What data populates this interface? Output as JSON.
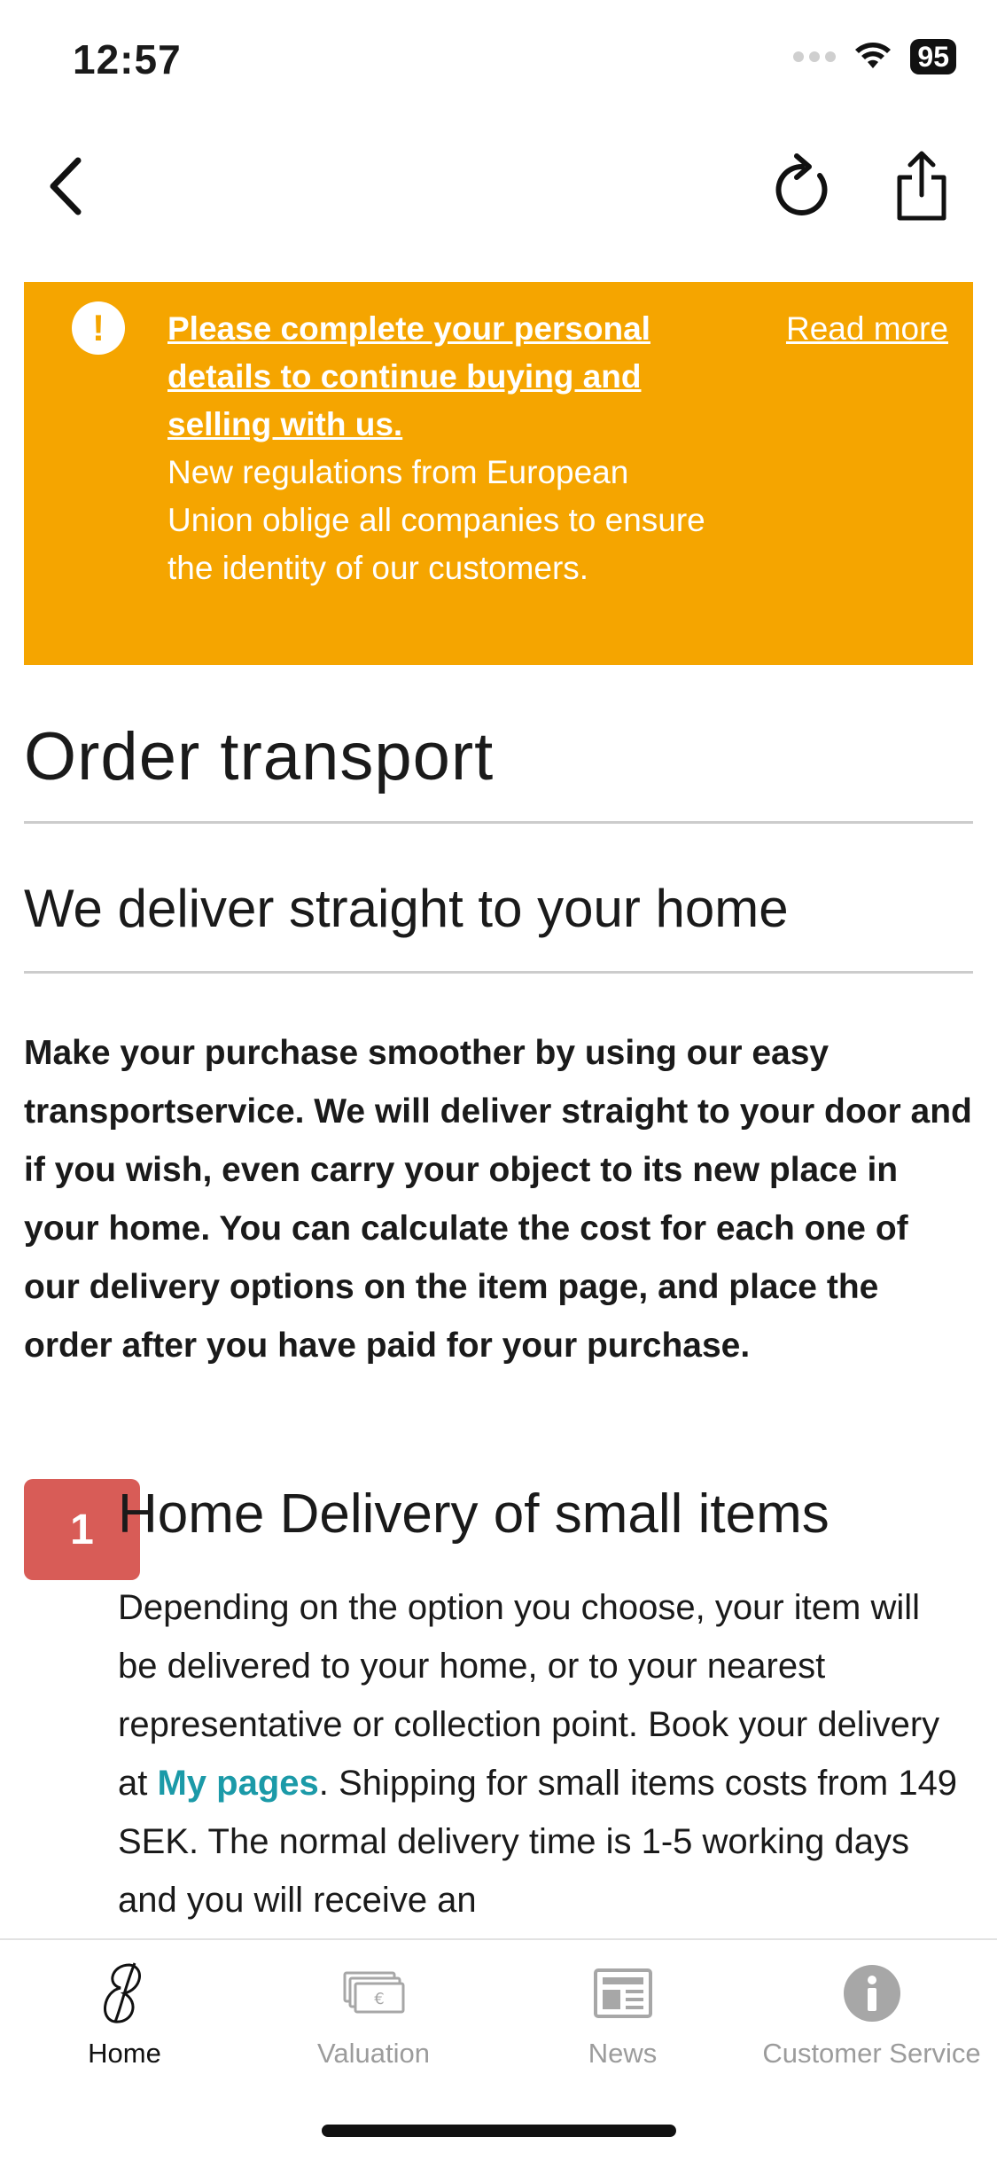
{
  "status": {
    "time": "12:57",
    "battery": "95"
  },
  "banner": {
    "title": "Please complete your personal details to continue buying and selling with us.",
    "text": "New regulations from European Union oblige all companies to ensure the identity of our customers.",
    "link": "Read more",
    "icon_glyph": "!",
    "color": "#f5a500"
  },
  "page": {
    "title": "Order transport",
    "subtitle": "We deliver straight to your home",
    "intro": "Make your purchase smoother by using our easy transportservice. We will deliver straight to your door and if you wish, even carry your object to its new place in your home. You can calculate the cost for each one of our delivery options on the item page, and place the order after you have paid for your purchase."
  },
  "step1": {
    "number": "1",
    "title": "Home Delivery of small items",
    "text_before": "Depending on the option you choose, your item will be delivered to your home, or to your nearest representative or collection point. Book your delivery at ",
    "link": "My pages",
    "text_after": ". Shipping for small items costs from 149 SEK. The normal delivery time is 1-5 working days and you will receive an",
    "badge_color": "#d85c57",
    "link_color": "#1b9aa8"
  },
  "tabs": [
    {
      "label": "Home",
      "icon": "home-logo-icon",
      "active": true
    },
    {
      "label": "Valuation",
      "icon": "banknotes-icon",
      "active": false
    },
    {
      "label": "News",
      "icon": "newspaper-icon",
      "active": false
    },
    {
      "label": "Customer Service",
      "icon": "info-icon",
      "active": false
    }
  ]
}
